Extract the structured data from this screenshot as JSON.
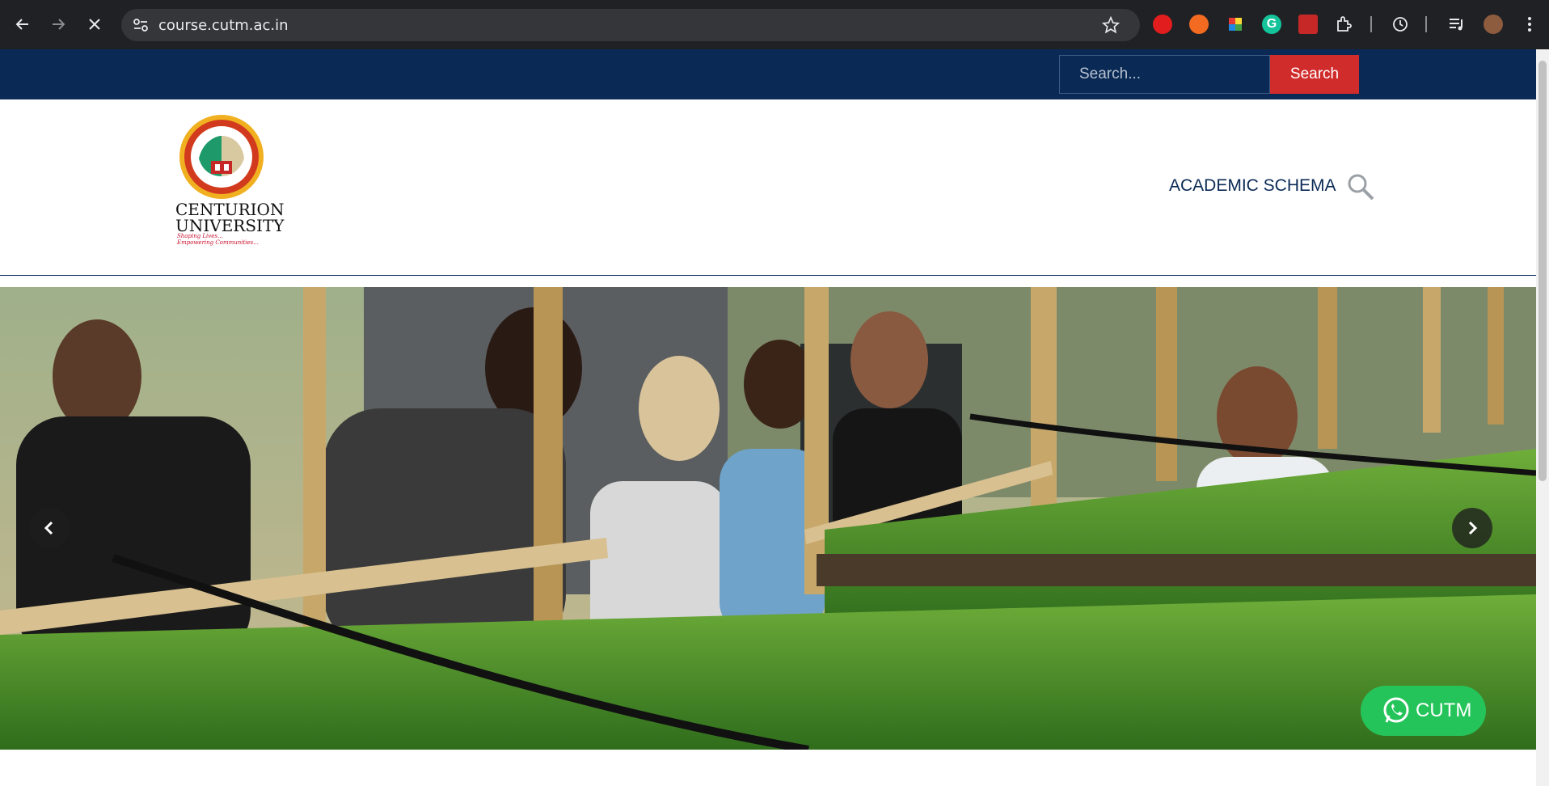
{
  "browser": {
    "url": "course.cutm.ac.in"
  },
  "topbar": {
    "search_placeholder": "Search...",
    "search_button": "Search"
  },
  "logo": {
    "line1": "CENTURION",
    "line2": "UNIVERSITY",
    "tagline1": "Shaping Lives...",
    "tagline2": "Empowering Communities..."
  },
  "nav": {
    "academic_schema": "ACADEMIC SCHEMA"
  },
  "whatsapp": {
    "label": "CUTM"
  },
  "colors": {
    "topbar": "#0a2a55",
    "search_button": "#d12c2c",
    "whatsapp": "#25c45a"
  }
}
